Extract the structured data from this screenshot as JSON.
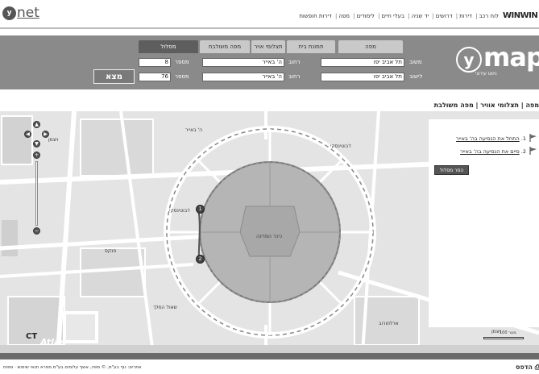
{
  "header": {
    "logo_left": "net",
    "logo_left_badge": "y",
    "top_links": [
      "לוח רכב",
      "דירות",
      "דרושים",
      "יד שניה",
      "בעלי חיים",
      "לימודים",
      "מפה",
      "דירות חופשות"
    ],
    "brand": "WINWIN"
  },
  "search": {
    "tabs": [
      "מפה",
      "תמונת בית",
      "תצלומי אויר",
      "מפה משולבת",
      "מסלול"
    ],
    "active_tab": "מסלול",
    "from_label": "משוב",
    "to_label": "לישוב",
    "street_label": "רחוב",
    "number_label": "מספר",
    "from_city": "תל אביב יפו",
    "to_city": "תל אביב יפו",
    "from_street": "ה' באייר",
    "to_street": "ה' באייר",
    "from_number": "8",
    "to_number": "76",
    "find_button": "מצא",
    "logo_letter": "y",
    "logo_word": "map",
    "logo_sub": "ניווט עירוני"
  },
  "view_links": [
    "מפה",
    "תצלומי אוויר",
    "מפה משולבת"
  ],
  "route": {
    "steps": [
      {
        "num": "1.",
        "text": "התחל את הנסיעה בה' באייר"
      },
      {
        "num": "2.",
        "text": "סיים את הנסיעה בה' באייר"
      }
    ],
    "hide_button": "הסר מסלול"
  },
  "map": {
    "watermark": "Atlas",
    "corner_mark": "CT",
    "square_label": "כיכר המדינה",
    "streets": [
      "ויצמן",
      "ז'בוטינסקי",
      "פנקס",
      "שאול המלך",
      "ה' באייר",
      "ארלוזורוב",
      "ז'בוטינסקי",
      "ויצמן"
    ],
    "scale_label": "100 מטר"
  },
  "footer": {
    "text": "אתרים: נוף בע\"מ, © מפה, אשף עלומים בע\"מ  מפרא  תנאי שימוש · מפות",
    "print": "הדפס"
  }
}
